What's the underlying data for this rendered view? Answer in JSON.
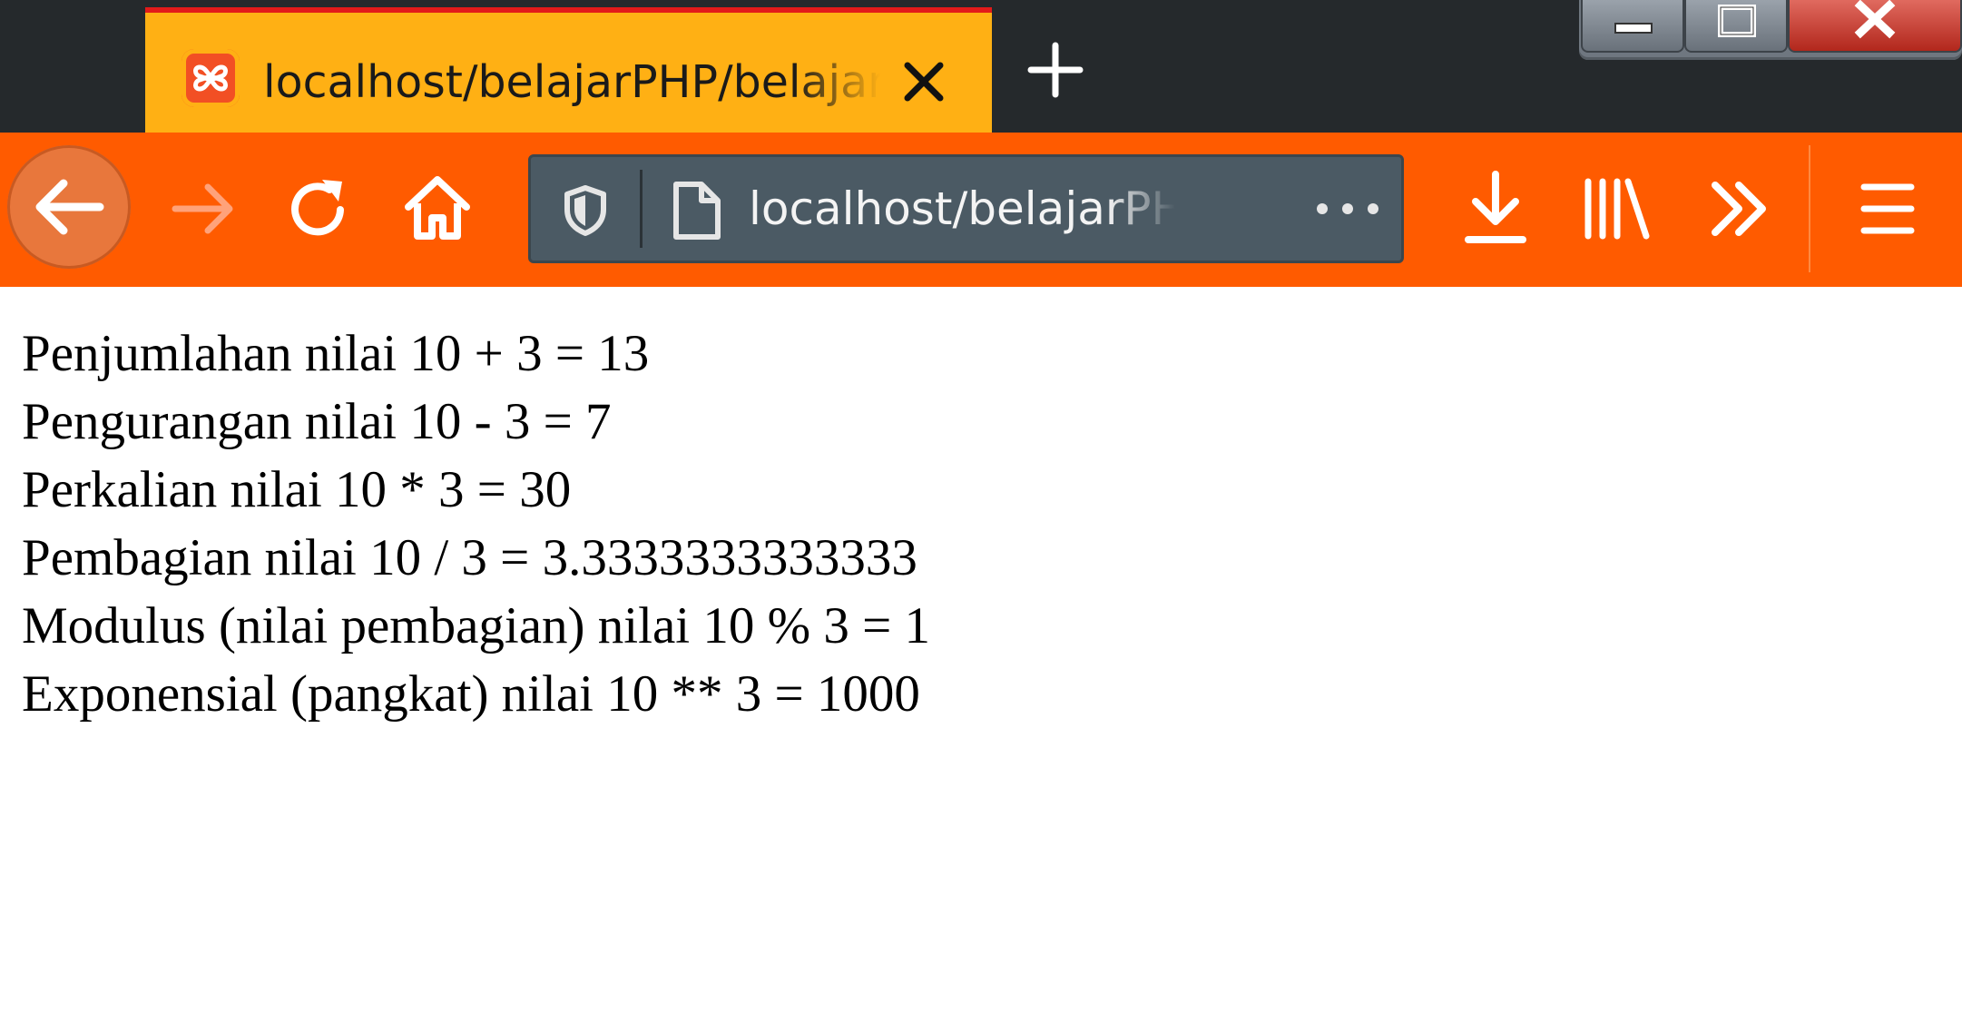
{
  "browser": {
    "tab": {
      "title": "localhost/belajarPHP/belajar.php",
      "favicon": "xampp-icon"
    },
    "url": "localhost/belajarPHP/belajar.php",
    "colors": {
      "tab_background": "#ffb014",
      "toolbar_background": "#ff5b00",
      "tab_strip_background": "#25292c",
      "url_field_background": "#4b5a64"
    }
  },
  "page": {
    "lines": [
      "Penjumlahan nilai 10 + 3 = 13",
      "Pengurangan nilai 10 - 3 = 7",
      "Perkalian nilai 10 * 3 = 30",
      "Pembagian nilai 10 / 3 = 3.3333333333333",
      "Modulus (nilai pembagian) nilai 10 % 3 = 1",
      "Exponensial (pangkat) nilai 10 ** 3 = 1000"
    ]
  }
}
